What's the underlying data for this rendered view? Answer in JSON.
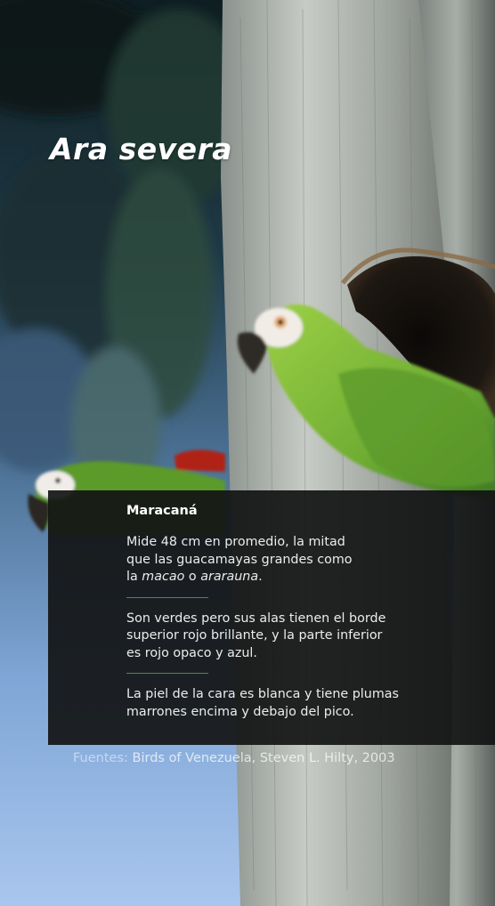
{
  "title": "Ara severa",
  "panel": {
    "heading": "Maracaná",
    "p1_a": "Mide 48 cm en promedio, la mitad",
    "p1_b": "que las guacamayas grandes como",
    "p1_c_pre": "la ",
    "p1_c_em1": "macao",
    "p1_c_mid": " o ",
    "p1_c_em2": "ararauna",
    "p1_c_end": ".",
    "p2_a": "Son verdes pero sus alas tienen el borde",
    "p2_b": "superior rojo brillante, y la parte inferior",
    "p2_c": "es rojo opaco y azul.",
    "p3_a": "La piel de la cara es blanca y tiene plumas",
    "p3_b": "marrones encima y debajo del pico."
  },
  "sources": {
    "label": "Fuentes:",
    "text": "Birds of Venezuela, Steven L. Hilty, 2003"
  },
  "colors": {
    "panel_bg": "#121414",
    "divider": "#4f8a3a",
    "parrot_green": "#7ab83a",
    "wing_red": "#c0261c"
  }
}
